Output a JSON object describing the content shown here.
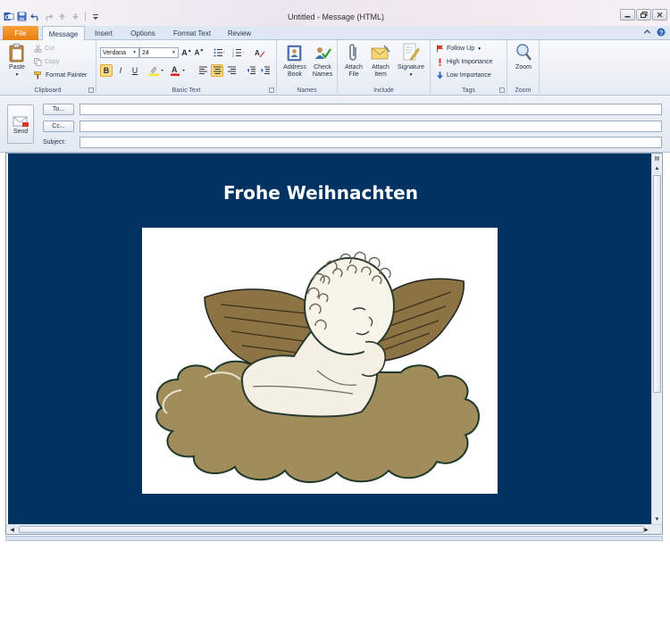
{
  "window": {
    "title": "Untitled  -  Message (HTML)"
  },
  "tabs": {
    "file": "File",
    "items": [
      "Message",
      "Insert",
      "Options",
      "Format Text",
      "Review"
    ],
    "active": "Message"
  },
  "ribbon": {
    "clipboard": {
      "label": "Clipboard",
      "paste": "Paste",
      "cut": "Cut",
      "copy": "Copy",
      "format_painter": "Format Painter"
    },
    "basic_text": {
      "label": "Basic Text",
      "font": "Verdana",
      "size": "24",
      "bold": "B",
      "italic": "I",
      "underline": "U"
    },
    "names": {
      "label": "Names",
      "address_book": [
        "Address",
        "Book"
      ],
      "check_names": [
        "Check",
        "Names"
      ]
    },
    "include": {
      "label": "Include",
      "attach_file": [
        "Attach",
        "File"
      ],
      "attach_item": [
        "Attach",
        "Item"
      ],
      "signature": "Signature"
    },
    "tags": {
      "label": "Tags",
      "follow_up": "Follow Up",
      "high": "High Importance",
      "low": "Low Importance"
    },
    "zoom": {
      "label": "Zoom",
      "zoom": "Zoom"
    }
  },
  "header": {
    "send": "Send",
    "to_button": "To...",
    "cc_button": "Cc...",
    "subject_label": "Subject:",
    "to_value": "",
    "cc_value": "",
    "subject_value": ""
  },
  "message": {
    "greeting": "Frohe Weihnachten"
  },
  "colors": {
    "message_bg": "#003262",
    "file_tab": "#e97c10",
    "greeting": "#ffffff"
  }
}
